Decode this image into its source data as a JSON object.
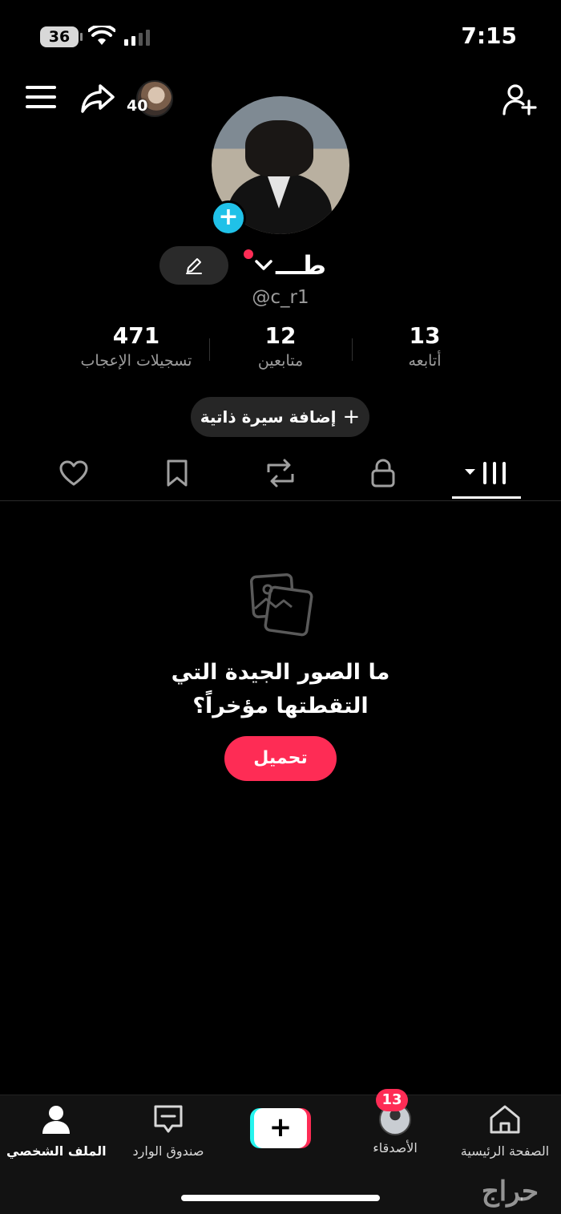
{
  "status_bar": {
    "battery": "36",
    "time": "7:15"
  },
  "top_nav": {
    "story_count": "40"
  },
  "profile": {
    "display_name": "طـــ",
    "username": "@c_r1",
    "stats": {
      "likes": {
        "value": "471",
        "label": "تسجيلات الإعجاب"
      },
      "followers": {
        "value": "12",
        "label": "متابعين"
      },
      "following": {
        "value": "13",
        "label": "أتابعه"
      }
    },
    "bio_button": "إضافة سيرة ذاتية"
  },
  "tabs": [
    {
      "name": "videos",
      "icon": "grid-icon",
      "active": true
    },
    {
      "name": "private",
      "icon": "lock-icon"
    },
    {
      "name": "reposts",
      "icon": "repost-icon"
    },
    {
      "name": "favorites",
      "icon": "bookmark-icon"
    },
    {
      "name": "liked",
      "icon": "heart-icon"
    }
  ],
  "empty_state": {
    "title_line1": "ما الصور الجيدة التي",
    "title_line2": "التقطتها مؤخراً؟",
    "button": "تحميل"
  },
  "bottom_nav": {
    "profile": "الملف الشخصي",
    "inbox": "صندوق الوارد",
    "friends": "الأصدقاء",
    "friends_badge": "13",
    "home": "الصفحة الرئيسية"
  },
  "watermark": "حراج",
  "colors": {
    "accent": "#fe2c55",
    "cyan": "#25f4ee",
    "plus_badge": "#20c1e8",
    "background": "#000000"
  }
}
